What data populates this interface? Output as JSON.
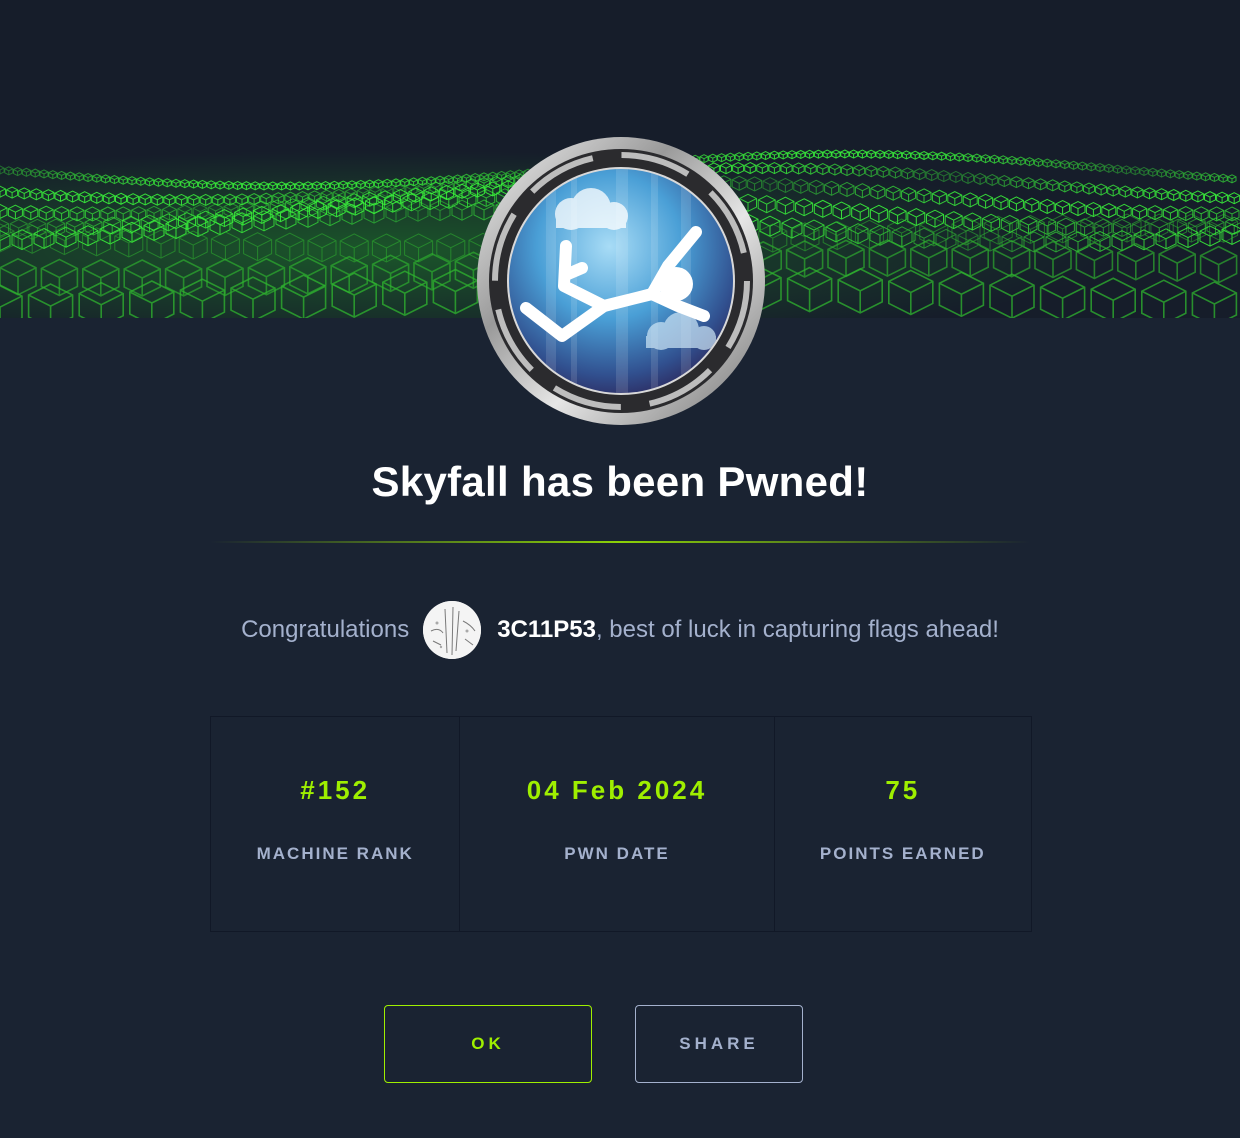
{
  "banner": {
    "icon": "green-cube-wave-banner",
    "accent_color": "#9fef00"
  },
  "machine": {
    "badge_icon": "skyfall-falling-figure-badge"
  },
  "title": "Skyfall has been Pwned!",
  "congrats": {
    "lead": "Congratulations",
    "username": "3C11P53",
    "tail": ", best of luck in capturing flags ahead!",
    "avatar_icon": "user-avatar"
  },
  "stats": [
    {
      "value": "#152",
      "label": "MACHINE RANK"
    },
    {
      "value": "04 Feb 2024",
      "label": "PWN DATE"
    },
    {
      "value": "75",
      "label": "POINTS EARNED"
    }
  ],
  "buttons": {
    "ok_label": "OK",
    "share_label": "SHARE"
  },
  "colors": {
    "background": "#1a2332",
    "accent": "#9fef00",
    "muted_text": "#a4b1cd",
    "badge_red": "#e8000f"
  }
}
